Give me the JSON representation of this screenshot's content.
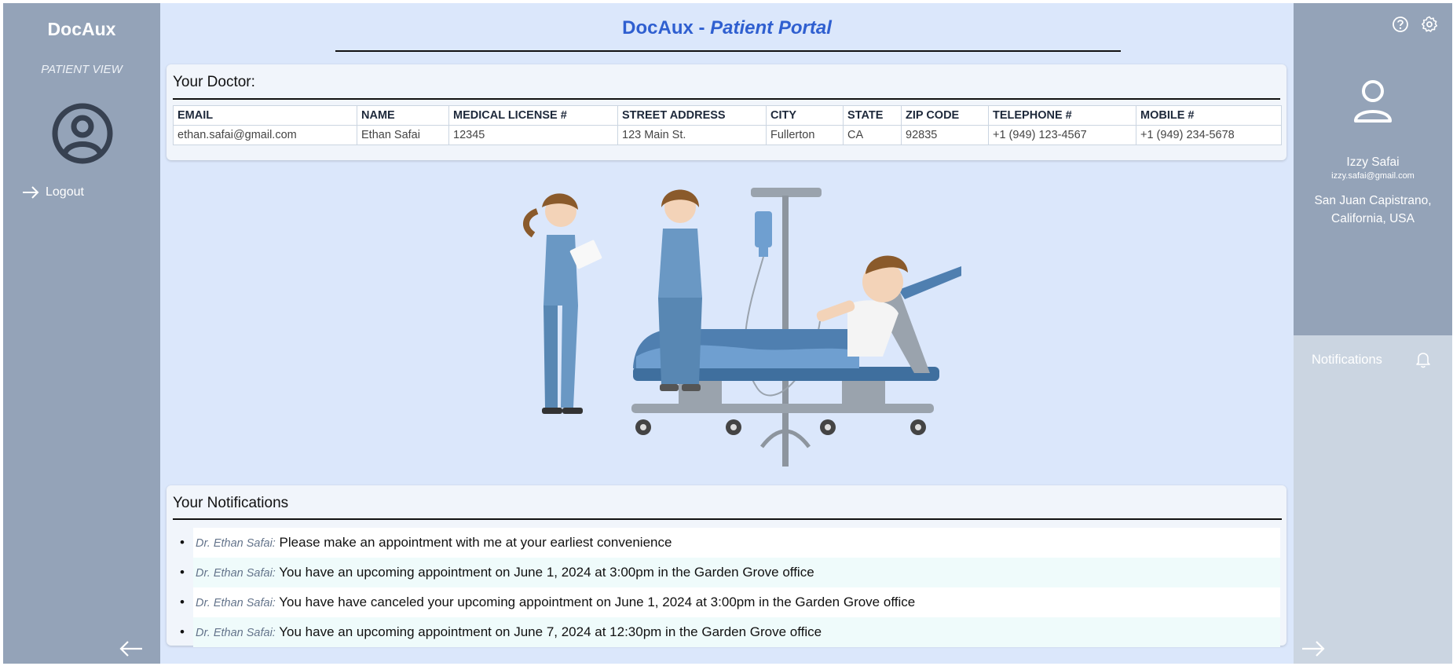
{
  "left_sidebar": {
    "brand": "DocAux",
    "view_label": "PATIENT VIEW",
    "logout_label": "Logout"
  },
  "header": {
    "title_main": "DocAux - ",
    "title_italic": "Patient Portal"
  },
  "doctor_card": {
    "title": "Your Doctor:",
    "columns": [
      "EMAIL",
      "NAME",
      "MEDICAL LICENSE #",
      "STREET ADDRESS",
      "CITY",
      "STATE",
      "ZIP CODE",
      "TELEPHONE #",
      "MOBILE #"
    ],
    "row": [
      "ethan.safai@gmail.com",
      "Ethan Safai",
      "12345",
      "123 Main St.",
      "Fullerton",
      "CA",
      "92835",
      "+1 (949) 123-4567",
      "+1 (949) 234-5678"
    ]
  },
  "notifications_card": {
    "title": "Your Notifications",
    "items": [
      {
        "sender": "Dr. Ethan Safai:",
        "message": " Please make an appointment with me at your earliest convenience"
      },
      {
        "sender": "Dr. Ethan Safai:",
        "message": " You have an upcoming appointment on June 1, 2024 at 3:00pm in the Garden Grove office"
      },
      {
        "sender": "Dr. Ethan Safai:",
        "message": " You have have canceled your upcoming appointment on June 1, 2024 at 3:00pm in the Garden Grove office"
      },
      {
        "sender": "Dr. Ethan Safai:",
        "message": " You have an upcoming appointment on June 7, 2024 at 12:30pm in the Garden Grove office"
      }
    ]
  },
  "right_panel": {
    "user_name": "Izzy Safai",
    "user_email": "izzy.safai@gmail.com",
    "location_line1": "San Juan Capistrano,",
    "location_line2": "California, USA",
    "notifications_label": "Notifications"
  },
  "icons": {
    "help": "help-circle-icon",
    "settings": "gear-icon",
    "bell": "bell-icon",
    "avatar": "user-icon",
    "back": "arrow-left-icon",
    "forward": "arrow-right-icon"
  },
  "colors": {
    "sidebar": "#94a3b8",
    "main_bg": "#dbe7fb",
    "card_bg": "#f1f5fb",
    "title_blue": "#2f5fd0",
    "notif_panel": "#cbd5e1"
  }
}
